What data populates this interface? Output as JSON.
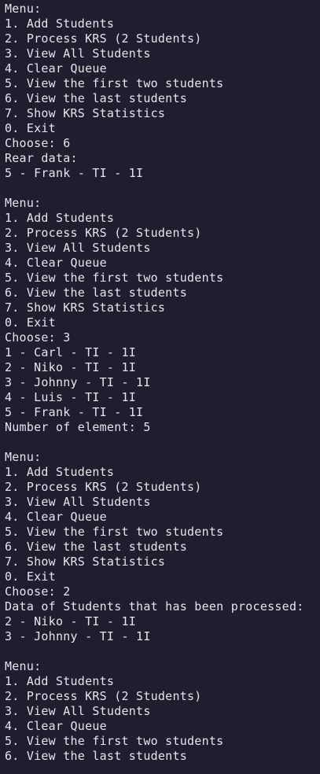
{
  "terminal": {
    "lines": [
      "Menu:",
      "1. Add Students",
      "2. Process KRS (2 Students)",
      "3. View All Students",
      "4. Clear Queue",
      "5. View the first two students",
      "6. View the last students",
      "7. Show KRS Statistics",
      "0. Exit",
      "Choose: 6",
      "Rear data:",
      "5 - Frank - TI - 1I",
      "",
      "Menu:",
      "1. Add Students",
      "2. Process KRS (2 Students)",
      "3. View All Students",
      "4. Clear Queue",
      "5. View the first two students",
      "6. View the last students",
      "7. Show KRS Statistics",
      "0. Exit",
      "Choose: 3",
      "1 - Carl - TI - 1I",
      "2 - Niko - TI - 1I",
      "3 - Johnny - TI - 1I",
      "4 - Luis - TI - 1I",
      "5 - Frank - TI - 1I",
      "Number of element: 5",
      "",
      "Menu:",
      "1. Add Students",
      "2. Process KRS (2 Students)",
      "3. View All Students",
      "4. Clear Queue",
      "5. View the first two students",
      "6. View the last students",
      "7. Show KRS Statistics",
      "0. Exit",
      "Choose: 2",
      "Data of Students that has been processed:",
      "2 - Niko - TI - 1I",
      "3 - Johnny - TI - 1I",
      "",
      "Menu:",
      "1. Add Students",
      "2. Process KRS (2 Students)",
      "3. View All Students",
      "4. Clear Queue",
      "5. View the first two students",
      "6. View the last students"
    ]
  }
}
